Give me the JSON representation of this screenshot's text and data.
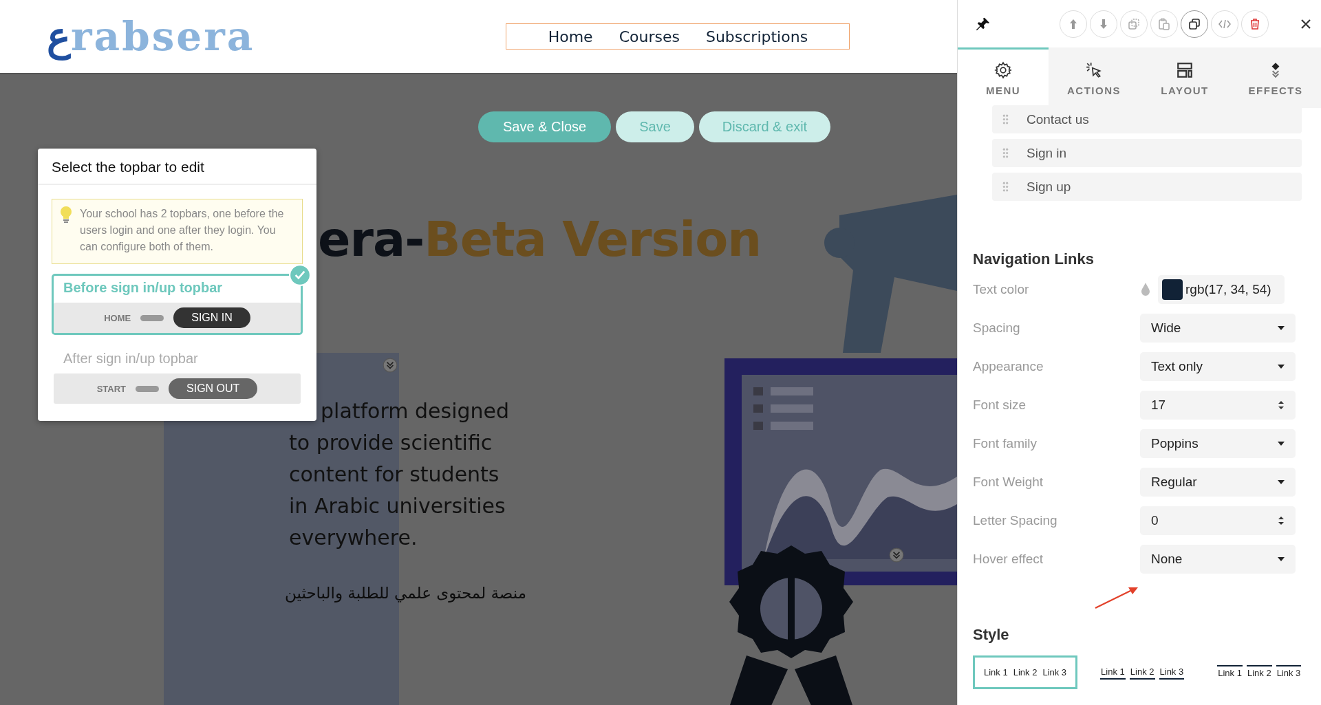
{
  "logo": {
    "mark": "ع",
    "text": "rabsera"
  },
  "nav": [
    "Home",
    "Courses",
    "Subscriptions"
  ],
  "action_buttons": [
    {
      "label": "Save & Close",
      "kind": "primary"
    },
    {
      "label": "Save",
      "kind": "secondary"
    },
    {
      "label": "Discard & exit",
      "kind": "secondary"
    }
  ],
  "hero": {
    "title_parts": [
      {
        "text": "era-",
        "kind": "plain"
      },
      {
        "text": "Beta Version",
        "kind": "accent"
      }
    ],
    "body": "platform designed to provide scientific content for students in Arabic universities everywhere.",
    "arabic": "منصة لمحتوى علمي للطلبة والباحثين"
  },
  "topbar_dialog": {
    "title": "Select the topbar to edit",
    "tip": "Your school has 2 topbars, one before the users login and one after they login. You can configure both of them.",
    "options": [
      {
        "title": "Before sign in/up topbar",
        "selected": true,
        "link": "HOME",
        "button": "SIGN IN"
      },
      {
        "title": "After sign in/up topbar",
        "selected": false,
        "link": "START",
        "button": "SIGN OUT"
      }
    ]
  },
  "panel": {
    "tabs": [
      {
        "label": "MENU",
        "selected": true
      },
      {
        "label": "ACTIONS",
        "selected": false
      },
      {
        "label": "LAYOUT",
        "selected": false
      },
      {
        "label": "EFFECTS",
        "selected": false
      }
    ],
    "menu_items": [
      "Contact us",
      "Sign in",
      "Sign up"
    ],
    "navigation_links": {
      "title": "Navigation Links",
      "rows": [
        {
          "label": "Text color",
          "kind": "color",
          "value": "rgb(17, 34, 54)"
        },
        {
          "label": "Spacing",
          "kind": "select",
          "value": "Wide"
        },
        {
          "label": "Appearance",
          "kind": "select",
          "value": "Text only"
        },
        {
          "label": "Font size",
          "kind": "number",
          "value": "17"
        },
        {
          "label": "Font family",
          "kind": "select",
          "value": "Poppins"
        },
        {
          "label": "Font Weight",
          "kind": "select",
          "value": "Regular"
        },
        {
          "label": "Letter Spacing",
          "kind": "number",
          "value": "0"
        },
        {
          "label": "Hover effect",
          "kind": "select",
          "value": "None"
        }
      ]
    },
    "style": {
      "title": "Style",
      "options": [
        {
          "kind": "boxed",
          "selected": true,
          "links": [
            "Link 1",
            "Link 2",
            "Link 3"
          ]
        },
        {
          "kind": "underline",
          "selected": false,
          "links": [
            "Link 1",
            "Link 2",
            "Link 3"
          ]
        },
        {
          "kind": "overline",
          "selected": false,
          "links": [
            "Link 1",
            "Link 2",
            "Link 3"
          ]
        }
      ]
    }
  }
}
